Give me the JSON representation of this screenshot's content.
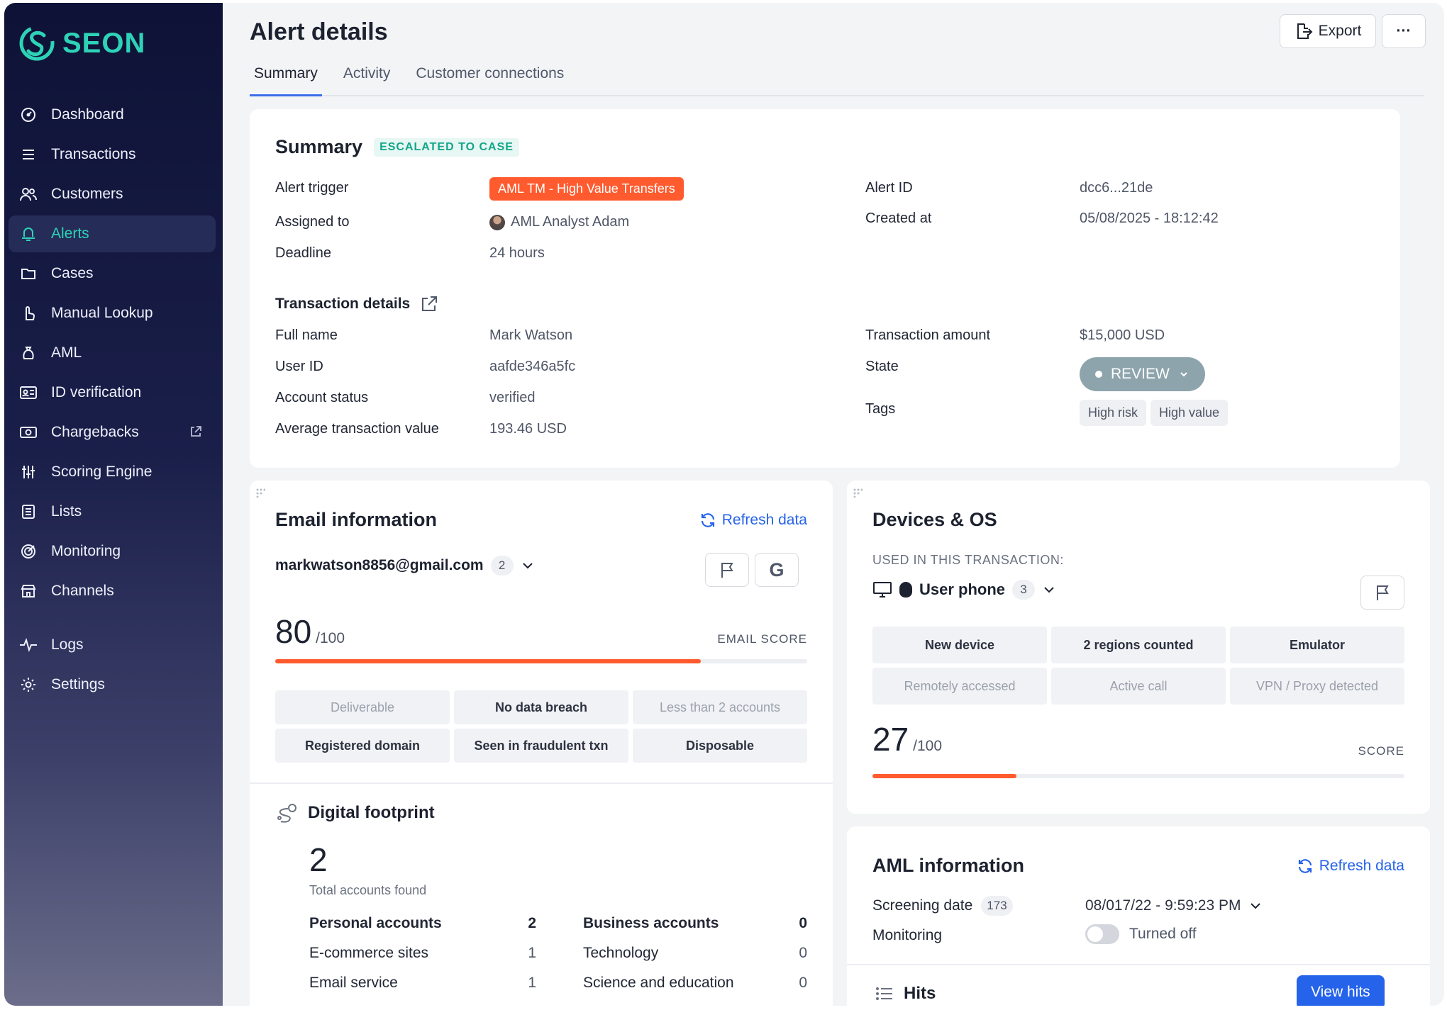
{
  "app": {
    "brand": "SEON"
  },
  "sidebar": {
    "items": [
      {
        "label": "Dashboard",
        "icon": "dashboard-icon"
      },
      {
        "label": "Transactions",
        "icon": "list-icon"
      },
      {
        "label": "Customers",
        "icon": "users-icon"
      },
      {
        "label": "Alerts",
        "icon": "bell-icon",
        "active": true
      },
      {
        "label": "Cases",
        "icon": "folder-icon"
      },
      {
        "label": "Manual Lookup",
        "icon": "pointer-icon"
      },
      {
        "label": "AML",
        "icon": "money-bag-icon"
      },
      {
        "label": "ID verification",
        "icon": "id-card-icon"
      },
      {
        "label": "Chargebacks",
        "icon": "money-icon",
        "external": true
      },
      {
        "label": "Scoring Engine",
        "icon": "sliders-icon"
      },
      {
        "label": "Lists",
        "icon": "list-box-icon"
      },
      {
        "label": "Monitoring",
        "icon": "target-icon"
      },
      {
        "label": "Channels",
        "icon": "store-icon"
      }
    ],
    "bottom_items": [
      {
        "label": "Logs",
        "icon": "pulse-icon"
      },
      {
        "label": "Settings",
        "icon": "gear-icon"
      }
    ]
  },
  "header": {
    "title": "Alert details",
    "export_label": "Export",
    "more_label": "···",
    "tabs": [
      "Summary",
      "Activity",
      "Customer connections"
    ]
  },
  "summary": {
    "title": "Summary",
    "status_badge": "ESCALATED TO CASE",
    "alert_trigger_label": "Alert trigger",
    "alert_trigger_value": "AML TM - High Value Transfers",
    "assigned_label": "Assigned to",
    "assigned_value": "AML Analyst Adam",
    "deadline_label": "Deadline",
    "deadline_value": "24 hours",
    "alert_id_label": "Alert ID",
    "alert_id_value": "dcc6...21de",
    "created_label": "Created at",
    "created_value": "05/08/2025 - 18:12:42",
    "txn_title": "Transaction details",
    "full_name_label": "Full name",
    "full_name_value": "Mark Watson",
    "user_id_label": "User ID",
    "user_id_value": "aafde346a5fc",
    "account_status_label": "Account status",
    "account_status_value": "verified",
    "avg_label": "Average transaction value",
    "avg_value": "193.46 USD",
    "amount_label": "Transaction amount",
    "amount_value": "$15,000 USD",
    "state_label": "State",
    "state_value": "REVIEW",
    "tags_label": "Tags",
    "tags": [
      "High risk",
      "High value"
    ]
  },
  "email": {
    "title": "Email information",
    "refresh_label": "Refresh data",
    "address": "markwatson8856@gmail.com",
    "count": "2",
    "score": "80",
    "score_max": "/100",
    "score_label": "EMAIL SCORE",
    "score_fraction": 0.8,
    "chips": [
      {
        "label": "Deliverable",
        "on": false
      },
      {
        "label": "No data breach",
        "on": true
      },
      {
        "label": "Less than 2 accounts",
        "on": false
      },
      {
        "label": "Registered domain",
        "on": true
      },
      {
        "label": "Seen in fraudulent txn",
        "on": true
      },
      {
        "label": "Disposable",
        "on": true
      }
    ]
  },
  "footprint": {
    "title": "Digital footprint",
    "total": "2",
    "total_label": "Total accounts found",
    "left": [
      {
        "label": "Personal accounts",
        "value": "2",
        "bold": true
      },
      {
        "label": "E-commerce sites",
        "value": "1"
      },
      {
        "label": "Email service",
        "value": "1"
      }
    ],
    "right": [
      {
        "label": "Business accounts",
        "value": "0",
        "bold": true
      },
      {
        "label": "Technology",
        "value": "0"
      },
      {
        "label": "Science and education",
        "value": "0"
      }
    ]
  },
  "devices": {
    "title": "Devices & OS",
    "subtitle": "USED IN THIS TRANSACTION:",
    "device_name": "User phone",
    "count": "3",
    "chips": [
      {
        "label": "New device",
        "on": true
      },
      {
        "label": "2 regions counted",
        "on": true
      },
      {
        "label": "Emulator",
        "on": true
      },
      {
        "label": "Remotely accessed",
        "on": false
      },
      {
        "label": "Active call",
        "on": false
      },
      {
        "label": "VPN / Proxy detected",
        "on": false
      }
    ],
    "score": "27",
    "score_max": "/100",
    "score_label": "SCORE",
    "score_fraction": 0.27
  },
  "aml": {
    "title": "AML information",
    "refresh_label": "Refresh data",
    "screening_label": "Screening date",
    "screening_count": "173",
    "screening_value": "08/017/22 - 9:59:23 PM",
    "monitoring_label": "Monitoring",
    "monitoring_value": "Turned off",
    "hits_label": "Hits",
    "view_hits_label": "View hits"
  },
  "colors": {
    "accent": "#2563eb",
    "brand": "#2ed3b7",
    "danger": "#ff5b2e"
  }
}
